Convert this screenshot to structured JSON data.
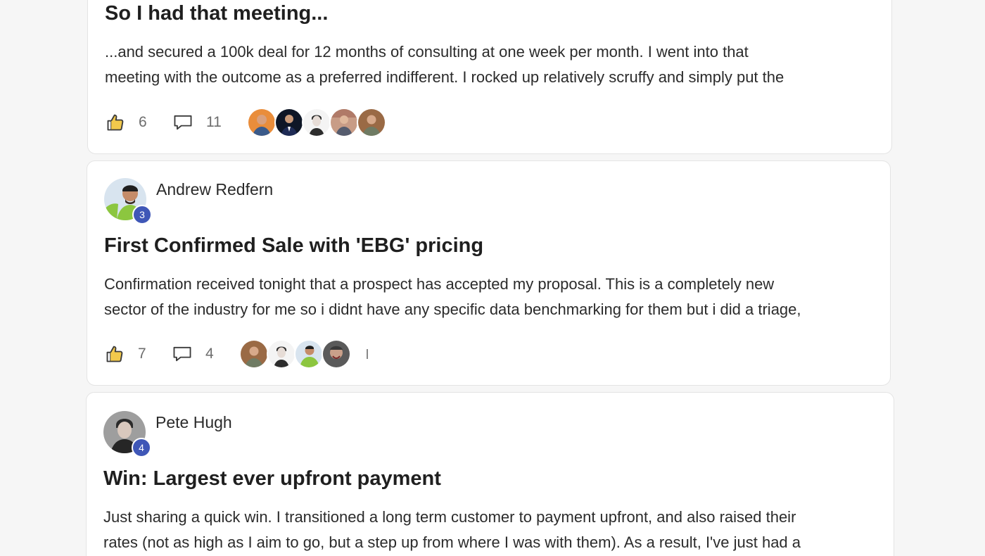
{
  "colors": {
    "page_bg": "#f6f6f6",
    "card_bg": "#ffffff",
    "level_badge": "#3f57b7",
    "icon_stroke": "#3a3a3a",
    "thumb_fill": "#f2c94c"
  },
  "posts": [
    {
      "title": "So I had that meeting...",
      "body_lines": [
        "...and secured a 100k deal for 12 months of consulting at one week per month. I went into that",
        "meeting with the outcome as a preferred indifferent. I rocked up relatively scruffy and simply put the"
      ],
      "likes": "6",
      "comments": "11",
      "like_icon": "thumbs-up-icon",
      "comment_icon": "comment-bubble-icon"
    },
    {
      "author": {
        "name": "Andrew Redfern",
        "level": "3"
      },
      "title": "First Confirmed Sale with 'EBG' pricing",
      "body_lines": [
        "Confirmation received tonight that a prospect has accepted my proposal. This is a completely new",
        "sector of the industry for me so i didnt have any specific data benchmarking for them but i did a triage,"
      ],
      "likes": "7",
      "comments": "4",
      "like_icon": "thumbs-up-icon",
      "comment_icon": "comment-bubble-icon"
    },
    {
      "author": {
        "name": "Pete Hugh",
        "level": "4"
      },
      "title": "Win: Largest ever upfront payment",
      "body_lines": [
        "Just sharing a quick win. I transitioned a long term customer to payment upfront, and also raised their",
        "rates (not as high as I aim to go, but a step up from where I was with them). As a result, I've just had a"
      ]
    }
  ]
}
